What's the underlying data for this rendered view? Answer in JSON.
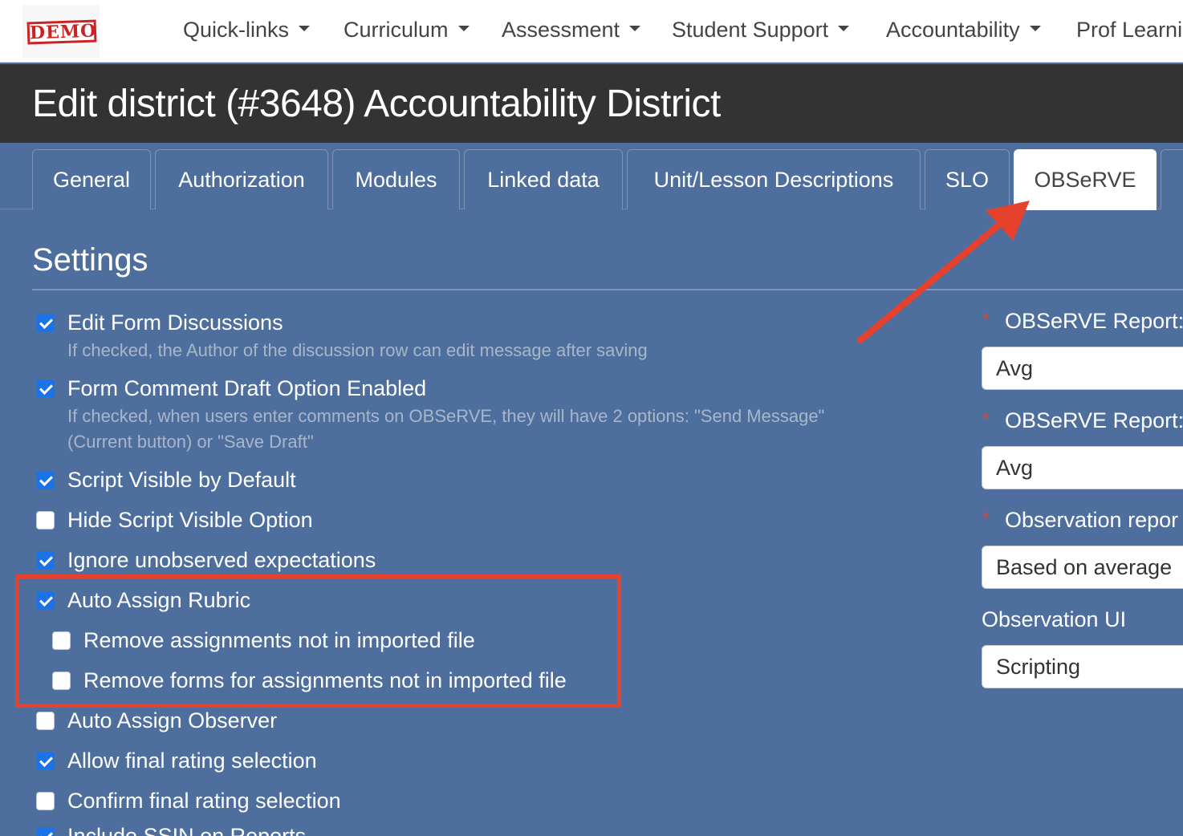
{
  "logo": {
    "text": "DEMO"
  },
  "nav": {
    "items": [
      {
        "label": "Quick-links"
      },
      {
        "label": "Curriculum"
      },
      {
        "label": "Assessment"
      },
      {
        "label": "Student Support"
      },
      {
        "label": "Accountability"
      },
      {
        "label": "Prof Learni"
      }
    ]
  },
  "page": {
    "title": "Edit district (#3648) Accountability District"
  },
  "tabs": [
    {
      "label": "General"
    },
    {
      "label": "Authorization"
    },
    {
      "label": "Modules"
    },
    {
      "label": "Linked data"
    },
    {
      "label": "Unit/Lesson Descriptions"
    },
    {
      "label": "SLO"
    },
    {
      "label": "OBSeRVE",
      "active": true
    }
  ],
  "settings": {
    "title": "Settings",
    "options": [
      {
        "label": "Edit Form Discussions",
        "checked": true,
        "help": "If checked, the Author of the discussion row can edit message after saving"
      },
      {
        "label": "Form Comment Draft Option Enabled",
        "checked": true,
        "help_line1": "If checked, when users enter comments on OBSeRVE, they will have 2 options: \"Send Message\"",
        "help_line2": "(Current button) or \"Save Draft\""
      },
      {
        "label": "Script Visible by Default",
        "checked": true
      },
      {
        "label": "Hide Script Visible Option",
        "checked": false
      },
      {
        "label": "Ignore unobserved expectations",
        "checked": true
      },
      {
        "label": "Auto Assign Rubric",
        "checked": true
      },
      {
        "label": "Remove assignments not in imported file",
        "checked": false
      },
      {
        "label": "Remove forms for assignments not in imported file",
        "checked": false
      },
      {
        "label": "Auto Assign Observer",
        "checked": false
      },
      {
        "label": "Allow final rating selection",
        "checked": true
      },
      {
        "label": "Confirm final rating selection",
        "checked": false
      },
      {
        "label": "Include SSIN on Reports",
        "checked": true
      }
    ]
  },
  "right": {
    "required_mark": "*",
    "fields": [
      {
        "label": "OBSeRVE Report:",
        "value": "Avg",
        "required": true
      },
      {
        "label": "OBSeRVE Report:",
        "value": "Avg",
        "required": true
      },
      {
        "label": "Observation repor",
        "value": "Based on average",
        "required": true
      },
      {
        "label": "Observation UI",
        "value": "Scripting",
        "required": false
      }
    ]
  },
  "annotation": {
    "color": "#e5412c"
  }
}
